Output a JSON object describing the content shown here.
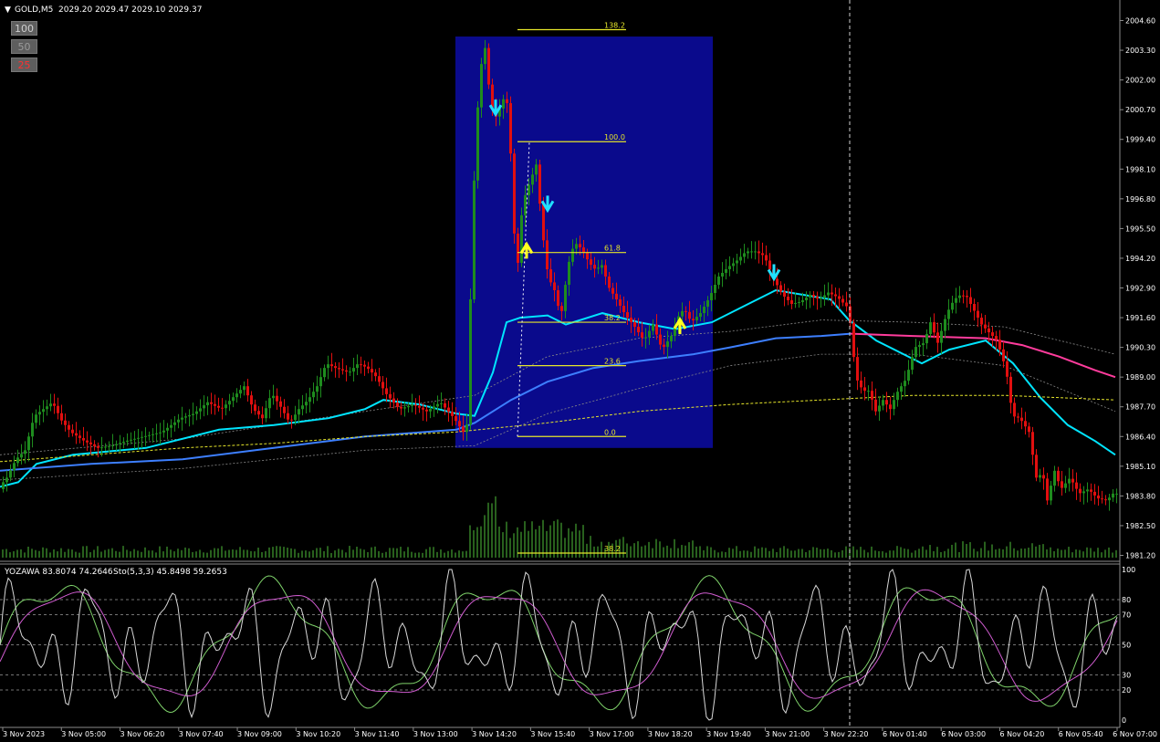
{
  "header": {
    "symbol": "GOLD,M5",
    "quote": "2029.20 2029.47 2029.10 2029.37"
  },
  "lot_buttons": [
    "100",
    "50",
    "25"
  ],
  "sub_header": {
    "indicator": "YOZAWA 83.8074 74.2646",
    "stoch": "Sto(5,3,3) 45.8498 59.2653"
  },
  "fibonacci": {
    "levels": [
      {
        "label": "138.2",
        "price": 2004.2
      },
      {
        "label": "100.0",
        "price": 1999.3
      },
      {
        "label": "61.8",
        "price": 1994.45
      },
      {
        "label": "38.2",
        "price": 1991.4
      },
      {
        "label": "23.6",
        "price": 1989.5
      },
      {
        "label": "0.0",
        "price": 1986.4
      },
      {
        "label": "38.2",
        "price": 1981.3
      }
    ]
  },
  "chart_data": {
    "type": "candlestick",
    "price_ticks": [
      "2004.60",
      "2003.30",
      "2002.00",
      "2000.70",
      "1999.40",
      "1998.10",
      "1996.80",
      "1995.50",
      "1994.20",
      "1992.90",
      "1991.60",
      "1990.30",
      "1989.00",
      "1987.70",
      "1986.40",
      "1985.10",
      "1983.80",
      "1982.50",
      "1981.20"
    ],
    "osc_ticks": [
      "100",
      "80",
      "70",
      "50",
      "30",
      "20",
      "0"
    ],
    "time_labels": [
      "3 Nov 2023",
      "3 Nov 05:00",
      "3 Nov 06:20",
      "3 Nov 07:40",
      "3 Nov 09:00",
      "3 Nov 10:20",
      "3 Nov 11:40",
      "3 Nov 13:00",
      "3 Nov 14:20",
      "3 Nov 15:40",
      "3 Nov 17:00",
      "3 Nov 18:20",
      "3 Nov 19:40",
      "3 Nov 21:00",
      "3 Nov 22:20",
      "6 Nov 01:40",
      "6 Nov 03:00",
      "6 Nov 04:20",
      "6 Nov 05:40",
      "6 Nov 07:00"
    ],
    "ylim": [
      1981.1,
      2004.9
    ],
    "osc_ylim": [
      0,
      100
    ],
    "grid": false,
    "close_path": [
      [
        0,
        1984.1
      ],
      [
        10,
        1984.6
      ],
      [
        20,
        1985.4
      ],
      [
        30,
        1985.8
      ],
      [
        40,
        1987.3
      ],
      [
        50,
        1987.6
      ],
      [
        60,
        1987.9
      ],
      [
        70,
        1987.1
      ],
      [
        80,
        1986.6
      ],
      [
        95,
        1986.2
      ],
      [
        110,
        1985.9
      ],
      [
        125,
        1986.0
      ],
      [
        140,
        1986.2
      ],
      [
        160,
        1986.4
      ],
      [
        180,
        1986.6
      ],
      [
        200,
        1987.2
      ],
      [
        215,
        1987.4
      ],
      [
        230,
        1987.9
      ],
      [
        245,
        1987.6
      ],
      [
        260,
        1988.2
      ],
      [
        270,
        1988.6
      ],
      [
        280,
        1987.6
      ],
      [
        290,
        1987.2
      ],
      [
        300,
        1988.3
      ],
      [
        310,
        1987.7
      ],
      [
        320,
        1987.0
      ],
      [
        330,
        1987.6
      ],
      [
        340,
        1988.0
      ],
      [
        350,
        1988.6
      ],
      [
        360,
        1989.6
      ],
      [
        370,
        1989.4
      ],
      [
        385,
        1989.2
      ],
      [
        395,
        1989.6
      ],
      [
        405,
        1989.4
      ],
      [
        415,
        1989.0
      ],
      [
        425,
        1988.3
      ],
      [
        440,
        1987.6
      ],
      [
        455,
        1987.8
      ],
      [
        470,
        1987.5
      ],
      [
        485,
        1987.9
      ],
      [
        500,
        1987.2
      ],
      [
        510,
        1986.6
      ],
      [
        515,
        1987.0
      ],
      [
        520,
        1996.0
      ],
      [
        527,
        2001.6
      ],
      [
        533,
        2003.8
      ],
      [
        540,
        2001.0
      ],
      [
        547,
        2000.3
      ],
      [
        553,
        2001.2
      ],
      [
        560,
        2000.9
      ],
      [
        565,
        1995.6
      ],
      [
        570,
        1994.0
      ],
      [
        575,
        1996.6
      ],
      [
        580,
        1997.2
      ],
      [
        590,
        1998.3
      ],
      [
        597,
        1995.3
      ],
      [
        603,
        1993.4
      ],
      [
        610,
        1992.8
      ],
      [
        617,
        1991.6
      ],
      [
        625,
        1993.9
      ],
      [
        632,
        1994.9
      ],
      [
        640,
        1994.6
      ],
      [
        648,
        1994.0
      ],
      [
        655,
        1993.7
      ],
      [
        662,
        1993.9
      ],
      [
        670,
        1992.9
      ],
      [
        678,
        1992.4
      ],
      [
        688,
        1991.7
      ],
      [
        698,
        1991.2
      ],
      [
        708,
        1990.6
      ],
      [
        718,
        1991.3
      ],
      [
        728,
        1990.2
      ],
      [
        738,
        1990.8
      ],
      [
        745,
        1991.6
      ],
      [
        752,
        1992.0
      ],
      [
        760,
        1991.4
      ],
      [
        770,
        1991.8
      ],
      [
        780,
        1992.5
      ],
      [
        790,
        1993.4
      ],
      [
        800,
        1993.8
      ],
      [
        810,
        1994.1
      ],
      [
        820,
        1994.5
      ],
      [
        830,
        1994.5
      ],
      [
        840,
        1994.3
      ],
      [
        850,
        1993.3
      ],
      [
        860,
        1992.6
      ],
      [
        870,
        1992.2
      ],
      [
        880,
        1992.3
      ],
      [
        890,
        1992.6
      ],
      [
        900,
        1992.4
      ],
      [
        910,
        1992.7
      ],
      [
        920,
        1992.5
      ],
      [
        930,
        1992.1
      ],
      [
        935,
        1991.2
      ],
      [
        940,
        1989.0
      ],
      [
        948,
        1988.4
      ],
      [
        955,
        1988.4
      ],
      [
        962,
        1987.5
      ],
      [
        970,
        1988.0
      ],
      [
        978,
        1987.6
      ],
      [
        985,
        1988.3
      ],
      [
        995,
        1988.9
      ],
      [
        1005,
        1990.3
      ],
      [
        1015,
        1990.5
      ],
      [
        1022,
        1991.4
      ],
      [
        1030,
        1990.5
      ],
      [
        1040,
        1991.8
      ],
      [
        1048,
        1992.4
      ],
      [
        1055,
        1992.6
      ],
      [
        1062,
        1992.5
      ],
      [
        1070,
        1991.9
      ],
      [
        1078,
        1991.3
      ],
      [
        1085,
        1991.0
      ],
      [
        1095,
        1990.6
      ],
      [
        1105,
        1989.3
      ],
      [
        1112,
        1987.3
      ],
      [
        1120,
        1987.2
      ],
      [
        1130,
        1986.6
      ],
      [
        1138,
        1984.6
      ],
      [
        1145,
        1984.8
      ],
      [
        1150,
        1983.6
      ],
      [
        1158,
        1984.9
      ],
      [
        1165,
        1984.1
      ],
      [
        1175,
        1984.6
      ],
      [
        1185,
        1983.9
      ],
      [
        1195,
        1984.1
      ],
      [
        1205,
        1983.7
      ],
      [
        1215,
        1983.6
      ],
      [
        1222,
        1983.9
      ]
    ],
    "series": [
      {
        "name": "",
        "color": "#00e5ff",
        "values": [
          [
            0,
            1984.2
          ],
          [
            20,
            1984.4
          ],
          [
            40,
            1985.2
          ],
          [
            80,
            1985.6
          ],
          [
            160,
            1985.9
          ],
          [
            240,
            1986.7
          ],
          [
            300,
            1986.9
          ],
          [
            360,
            1987.2
          ],
          [
            400,
            1987.6
          ],
          [
            420,
            1988.0
          ],
          [
            460,
            1987.8
          ],
          [
            500,
            1987.4
          ],
          [
            520,
            1987.3
          ],
          [
            540,
            1989.2
          ],
          [
            555,
            1991.4
          ],
          [
            570,
            1991.6
          ],
          [
            600,
            1991.7
          ],
          [
            620,
            1991.3
          ],
          [
            660,
            1991.8
          ],
          [
            700,
            1991.4
          ],
          [
            740,
            1991.1
          ],
          [
            780,
            1991.4
          ],
          [
            820,
            1992.2
          ],
          [
            850,
            1992.8
          ],
          [
            880,
            1992.6
          ],
          [
            910,
            1992.4
          ],
          [
            930,
            1991.5
          ],
          [
            960,
            1990.6
          ],
          [
            990,
            1990.0
          ],
          [
            1010,
            1989.6
          ],
          [
            1040,
            1990.2
          ],
          [
            1080,
            1990.6
          ],
          [
            1110,
            1989.6
          ],
          [
            1140,
            1988.1
          ],
          [
            1170,
            1986.9
          ],
          [
            1200,
            1986.2
          ],
          [
            1222,
            1985.6
          ]
        ]
      },
      {
        "name": "",
        "color": "#3d7fff",
        "values": [
          [
            0,
            1984.9
          ],
          [
            100,
            1985.2
          ],
          [
            200,
            1985.4
          ],
          [
            300,
            1985.9
          ],
          [
            400,
            1986.4
          ],
          [
            500,
            1986.7
          ],
          [
            520,
            1987.0
          ],
          [
            560,
            1988.0
          ],
          [
            600,
            1988.8
          ],
          [
            650,
            1989.4
          ],
          [
            700,
            1989.7
          ],
          [
            760,
            1990.0
          ],
          [
            800,
            1990.3
          ],
          [
            850,
            1990.7
          ],
          [
            900,
            1990.8
          ],
          [
            932,
            1990.9
          ]
        ]
      },
      {
        "name": "",
        "color": "#ff3c9c",
        "values": [
          [
            932,
            1990.9
          ],
          [
            1000,
            1990.8
          ],
          [
            1080,
            1990.7
          ],
          [
            1120,
            1990.4
          ],
          [
            1160,
            1989.9
          ],
          [
            1200,
            1989.3
          ],
          [
            1222,
            1989.0
          ]
        ]
      },
      {
        "name": "",
        "color": "#e5e52a",
        "values": [
          [
            0,
            1985.3
          ],
          [
            100,
            1985.6
          ],
          [
            200,
            1985.9
          ],
          [
            300,
            1986.1
          ],
          [
            400,
            1986.4
          ],
          [
            500,
            1986.6
          ],
          [
            600,
            1987.0
          ],
          [
            700,
            1987.5
          ],
          [
            800,
            1987.8
          ],
          [
            900,
            1988.0
          ],
          [
            1000,
            1988.2
          ],
          [
            1100,
            1988.2
          ],
          [
            1222,
            1988.0
          ]
        ]
      }
    ],
    "signals": {
      "down": [
        [
          543,
          2000.5
        ],
        [
          600,
          1996.3
        ],
        [
          848,
          1993.3
        ]
      ],
      "up": [
        [
          577,
          1994.5
        ],
        [
          745,
          1991.2
        ]
      ]
    },
    "zone": {
      "x0": 499,
      "x1": 781,
      "p_top": 2003.9,
      "p_bot": 1985.9
    }
  }
}
